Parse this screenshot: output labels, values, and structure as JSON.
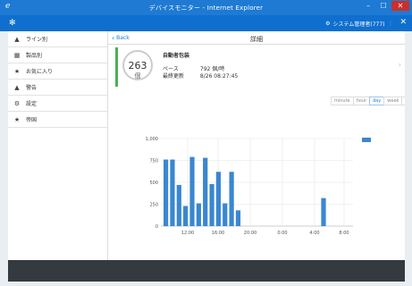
{
  "window": {
    "title": "デバイスモニター - Internet Explorer",
    "min": "–",
    "max": "☐",
    "close": "✕"
  },
  "toolbar": {
    "user_label": "システム管理者(777)"
  },
  "sidebar": {
    "items": [
      {
        "label": "ライン別",
        "icon": "warning-icon"
      },
      {
        "label": "製品別",
        "icon": "grid-icon"
      },
      {
        "label": "お気に入り",
        "icon": "star-icon"
      },
      {
        "label": "警告",
        "icon": "warning-icon"
      },
      {
        "label": "設定",
        "icon": "gear-icon"
      },
      {
        "label": "帝国",
        "icon": "star-icon"
      }
    ]
  },
  "main": {
    "back_label": "Back",
    "title": "詳細"
  },
  "summary": {
    "gauge_value": "263",
    "gauge_unit": "個",
    "line_name": "自動者包装",
    "pace_label": "ペース",
    "pace_value": "792 個/時",
    "updated_label": "最終更新",
    "updated_value": "8/26 08:27:45"
  },
  "range_tabs": [
    {
      "label": "minute",
      "active": false
    },
    {
      "label": "hour",
      "active": false
    },
    {
      "label": "day",
      "active": true
    },
    {
      "label": "week",
      "active": false
    },
    {
      "label": "month",
      "active": false
    }
  ],
  "colors": {
    "accent": "#1e7ad3",
    "status_ok": "#4cb050",
    "bar": "#3a87d0"
  },
  "chart_data": {
    "type": "bar",
    "ylim": [
      0,
      1000
    ],
    "yticks": [
      "0",
      "250",
      "500",
      "750",
      "1,000"
    ],
    "xticks": [
      "12:00",
      "16:00",
      "20:00",
      "0:00",
      "4:00",
      "8:00"
    ],
    "values": [
      760,
      760,
      470,
      230,
      790,
      260,
      780,
      480,
      620,
      260,
      620,
      180,
      320
    ],
    "bar_slots": [
      0,
      1,
      2,
      3,
      4,
      5,
      6,
      7,
      8,
      9,
      10,
      11,
      24
    ],
    "legend_swatch": true
  }
}
